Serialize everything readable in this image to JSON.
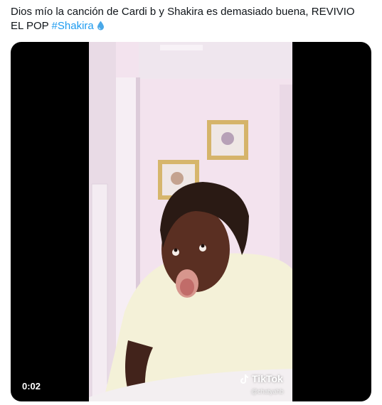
{
  "tweet": {
    "text": "Dios mío la canción de Cardi b y Shakira es demasiado buena, REVIVIO EL POP ",
    "hashtag": "#Shakira",
    "emoji_icon": "droplet-icon"
  },
  "video": {
    "elapsed_time": "0:02",
    "watermark_brand": "TikTok",
    "watermark_handle": "@chatyahb"
  },
  "colors": {
    "hashtag": "#1d9bf0",
    "video_background": "#000000",
    "wall": "#f3e3ee",
    "shirt": "#f4f1d8"
  }
}
